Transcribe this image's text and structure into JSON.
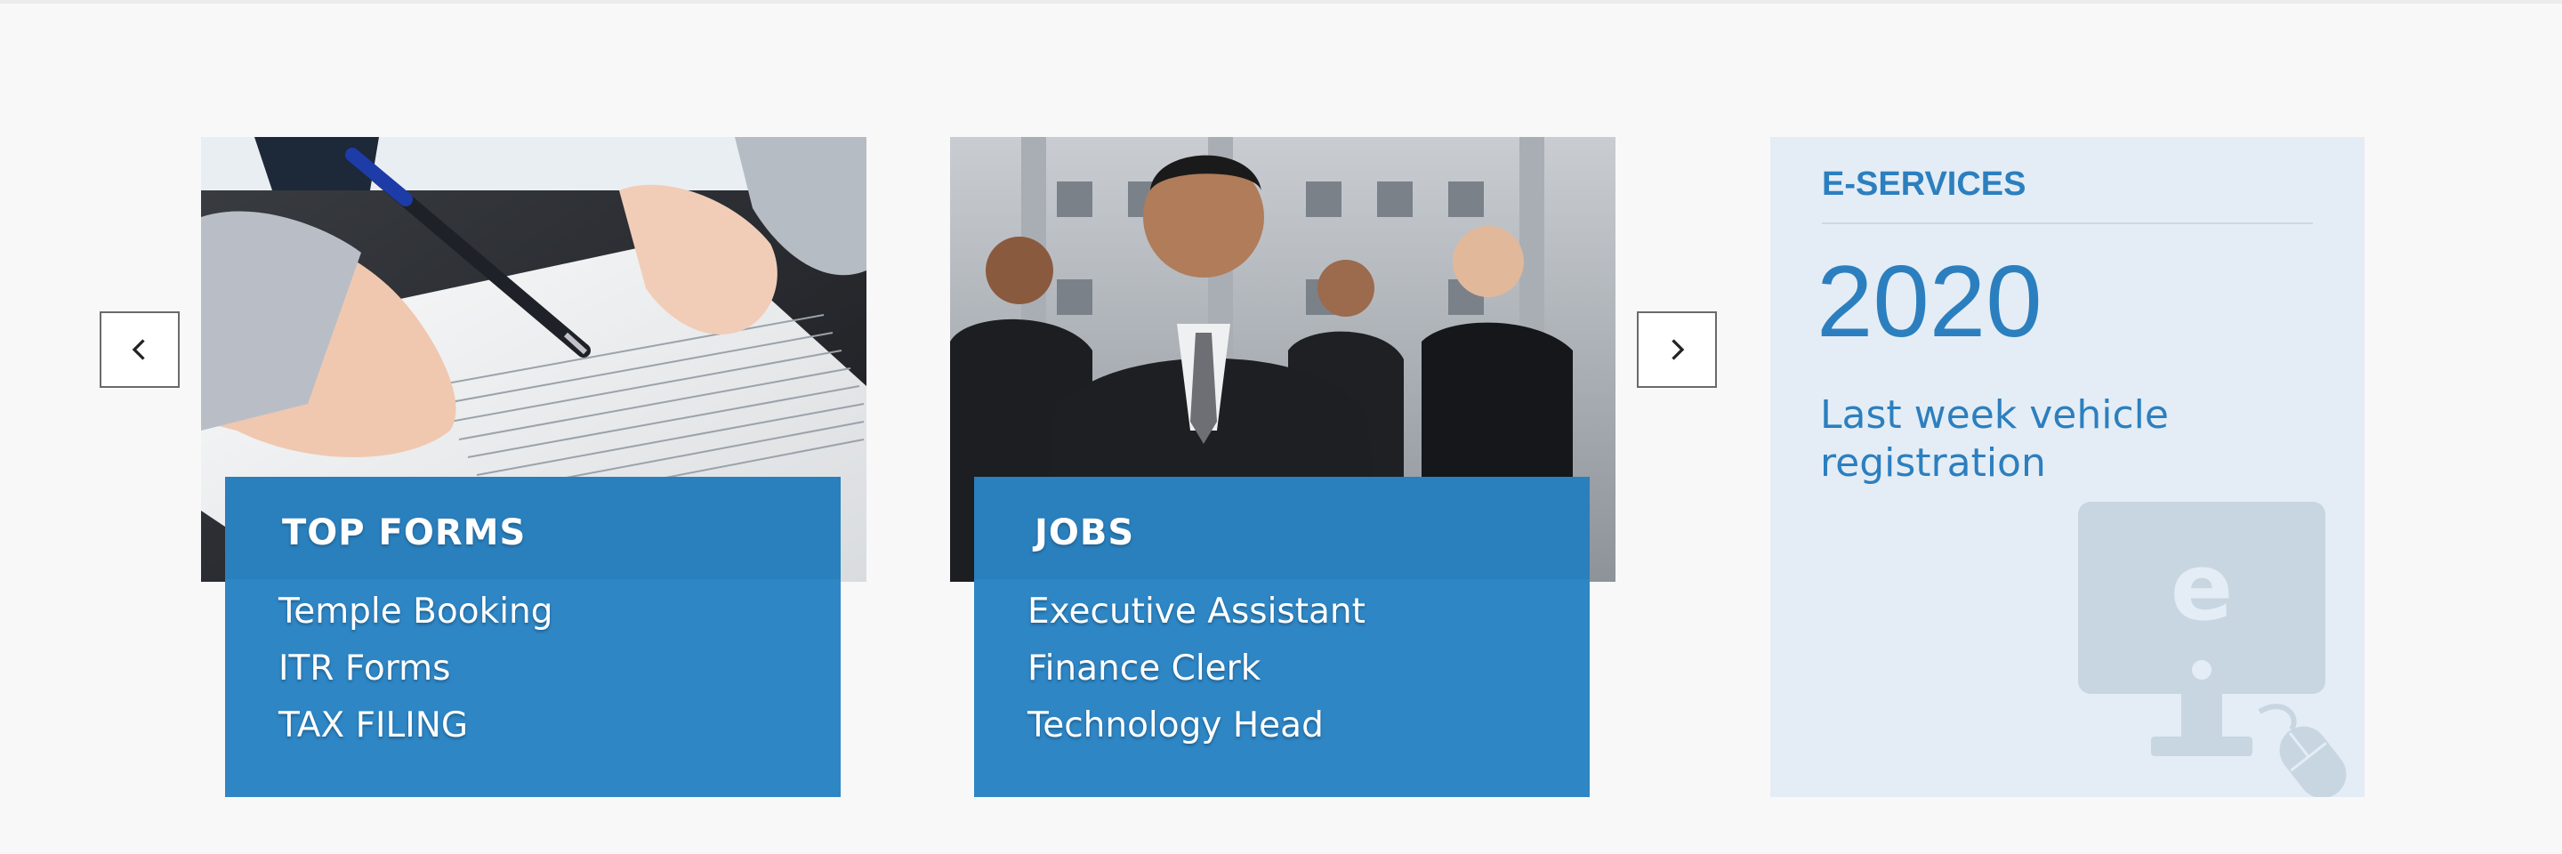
{
  "carousel": {
    "prev_icon": "chevron-left-icon",
    "next_icon": "chevron-right-icon"
  },
  "cards": {
    "forms": {
      "title": "TOP FORMS",
      "items": [
        "Temple Booking",
        "ITR Forms",
        "TAX FILING"
      ]
    },
    "jobs": {
      "title": "JOBS",
      "items": [
        "Executive Assistant",
        "Finance Clerk",
        "Technology Head"
      ]
    }
  },
  "eservices": {
    "label": "E-SERVICES",
    "year": "2020",
    "description": "Last week vehicle registration",
    "icon": "computer-e-icon",
    "icon_letter": "e"
  },
  "colors": {
    "accent": "#2e86c5",
    "eservices_bg": "#e4edf5",
    "page_bg": "#f8f8f8"
  }
}
